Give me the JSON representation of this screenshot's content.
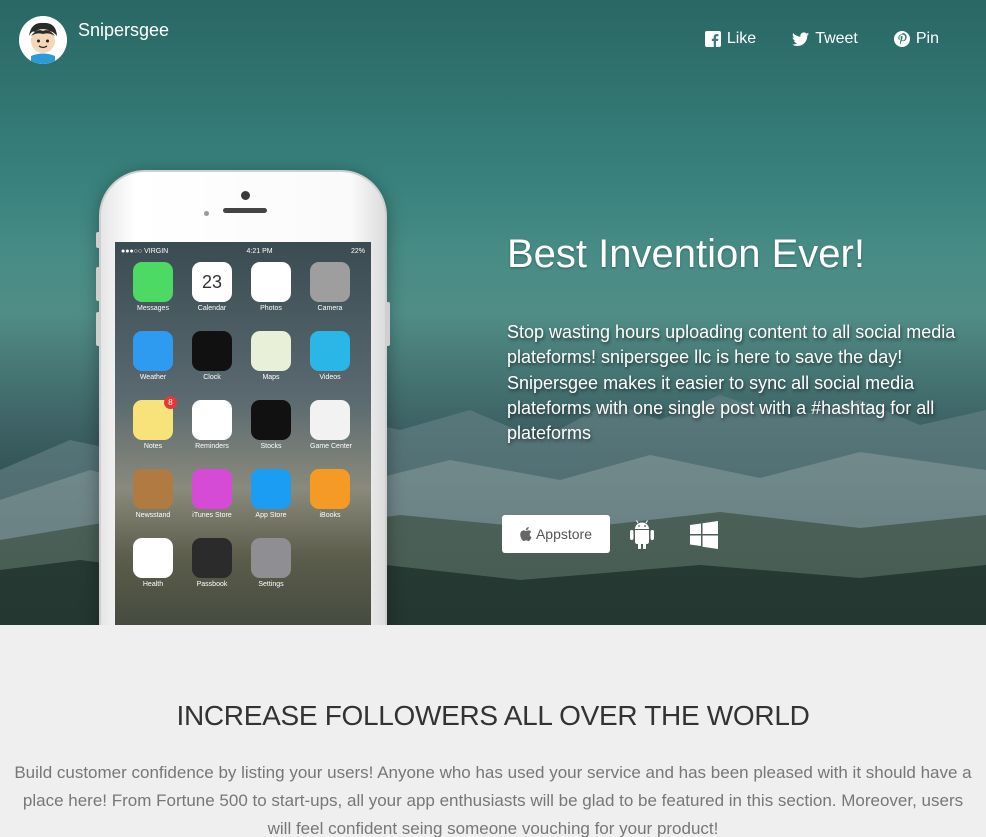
{
  "header": {
    "brand_name": "Snipersgee",
    "share": [
      {
        "label": "Like",
        "icon": "facebook-icon"
      },
      {
        "label": "Tweet",
        "icon": "twitter-icon"
      },
      {
        "label": "Pin",
        "icon": "pinterest-icon"
      }
    ]
  },
  "phone": {
    "status": {
      "carrier": "●●●○○ VIRGIN",
      "time": "4:21 PM",
      "battery": "22%"
    },
    "apps": [
      {
        "label": "Messages",
        "color": "#4cd964"
      },
      {
        "label": "Calendar",
        "color": "#ffffff",
        "text": "23"
      },
      {
        "label": "Photos",
        "color": "#ffffff"
      },
      {
        "label": "Camera",
        "color": "#9e9e9e"
      },
      {
        "label": "Weather",
        "color": "#2f9bf0"
      },
      {
        "label": "Clock",
        "color": "#111111"
      },
      {
        "label": "Maps",
        "color": "#e8f0d8"
      },
      {
        "label": "Videos",
        "color": "#2ab7e8"
      },
      {
        "label": "Notes",
        "color": "#f8e27a",
        "badge": "8"
      },
      {
        "label": "Reminders",
        "color": "#ffffff"
      },
      {
        "label": "Stocks",
        "color": "#111111"
      },
      {
        "label": "Game Center",
        "color": "#f2f2f2"
      },
      {
        "label": "Newsstand",
        "color": "#b07a43"
      },
      {
        "label": "iTunes Store",
        "color": "#d64bd6"
      },
      {
        "label": "App Store",
        "color": "#1a9df2"
      },
      {
        "label": "iBooks",
        "color": "#f59a25"
      },
      {
        "label": "Health",
        "color": "#ffffff"
      },
      {
        "label": "Passbook",
        "color": "#2b2b2b"
      },
      {
        "label": "Settings",
        "color": "#8e8e93"
      }
    ]
  },
  "hero": {
    "headline": "Best Invention Ever!",
    "lead": "Stop wasting hours uploading content to all social media plateforms! snipersgee llc is here to save the day! Snipersgee makes it easier to sync all social media plateforms with one single post with a #hashtag for all plateforms",
    "appstore_label": "Appstore",
    "platforms": [
      "android-icon",
      "windows-icon"
    ]
  },
  "features": {
    "title": "INCREASE FOLLOWERS ALL OVER THE WORLD",
    "text": "Build customer confidence by listing your users! Anyone who has used your service and has been pleased with it should have a place here! From Fortune 500 to start-ups, all your app enthusiasts will be glad to be featured in this section. Moreover, users will feel confident seing someone vouching for your product!"
  }
}
